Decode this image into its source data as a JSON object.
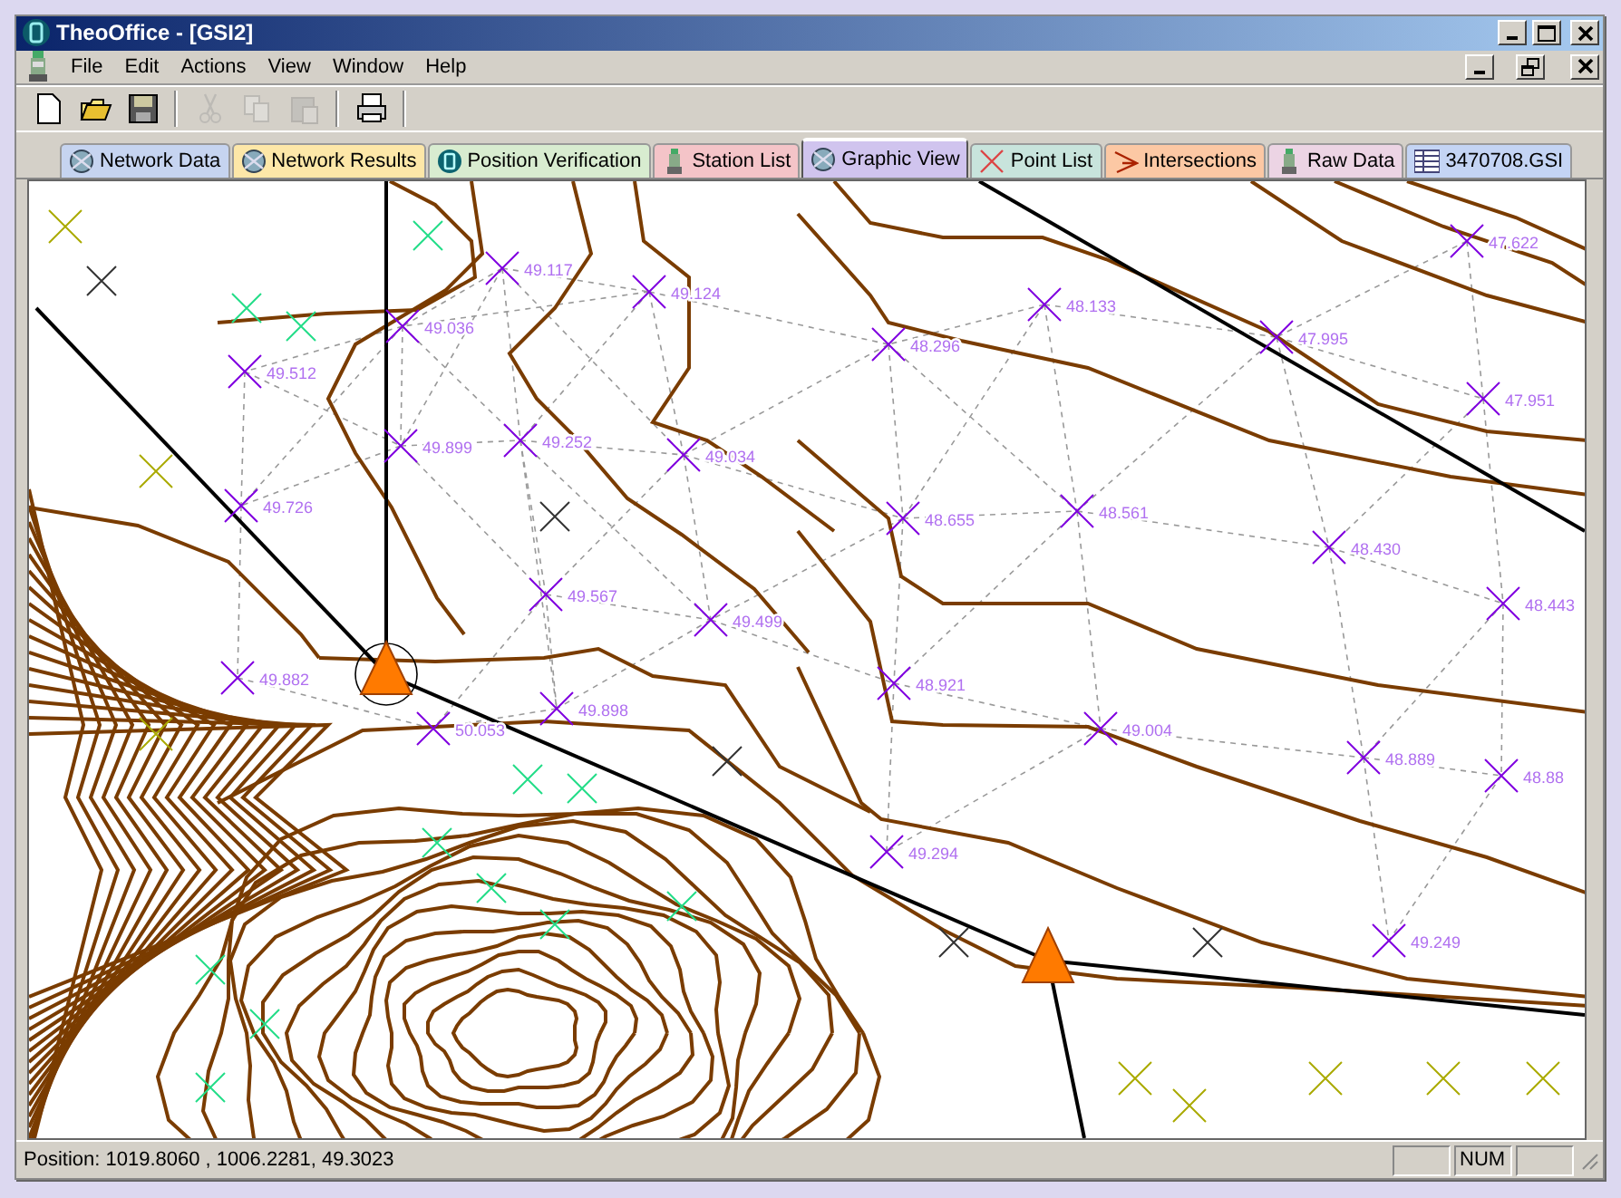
{
  "window": {
    "title": "TheoOffice - [GSI2]"
  },
  "menu": [
    "File",
    "Edit",
    "Actions",
    "View",
    "Window",
    "Help"
  ],
  "toolbar": [
    {
      "kind": "new",
      "disabled": false
    },
    {
      "kind": "open",
      "disabled": false
    },
    {
      "kind": "save",
      "disabled": false
    },
    {
      "kind": "separator"
    },
    {
      "kind": "cut",
      "disabled": true
    },
    {
      "kind": "copy",
      "disabled": true
    },
    {
      "kind": "paste",
      "disabled": true
    },
    {
      "kind": "separator"
    },
    {
      "kind": "print",
      "disabled": false
    },
    {
      "kind": "separator"
    }
  ],
  "tabs": [
    {
      "label": "Network Data",
      "kind": "globe",
      "color": "#c6d4f0",
      "selected": false
    },
    {
      "label": "Network Results",
      "kind": "globe",
      "color": "#fde7a8",
      "selected": false
    },
    {
      "label": "Position Verification",
      "kind": "logo",
      "color": "#d8ecd0",
      "selected": false
    },
    {
      "label": "Station List",
      "kind": "instrument",
      "color": "#f4c4c8",
      "selected": false
    },
    {
      "label": "Graphic View",
      "kind": "globe",
      "color": "#d0c4ee",
      "selected": true
    },
    {
      "label": "Point List",
      "kind": "cross",
      "color": "#c8e4dc",
      "selected": false
    },
    {
      "label": "Intersections",
      "kind": "angle",
      "color": "#fcc8a4",
      "selected": false
    },
    {
      "label": "Raw Data",
      "kind": "instrument",
      "color": "#ecd4e4",
      "selected": false
    },
    {
      "label": "3470708.GSI",
      "kind": "table",
      "color": "#c4d4f4",
      "selected": false
    }
  ],
  "map": {
    "points": [
      {
        "label": "47.622"
      },
      {
        "label": "49.117"
      },
      {
        "label": "49.124"
      },
      {
        "label": "48.133"
      },
      {
        "label": "49.036"
      },
      {
        "label": "48.296"
      },
      {
        "label": "47.995"
      },
      {
        "label": "49.512"
      },
      {
        "label": "47.951"
      },
      {
        "label": "49.899"
      },
      {
        "label": "49.252"
      },
      {
        "label": "49.034"
      },
      {
        "label": "49.726"
      },
      {
        "label": "48.655"
      },
      {
        "label": "48.561"
      },
      {
        "label": "48.430"
      },
      {
        "label": "49.567"
      },
      {
        "label": "48.443"
      },
      {
        "label": "49.499"
      },
      {
        "label": "49.882"
      },
      {
        "label": "48.921"
      },
      {
        "label": "49.898"
      },
      {
        "label": "50.053"
      },
      {
        "label": "49.004"
      },
      {
        "label": "48.889"
      },
      {
        "label": "48.88"
      },
      {
        "label": "49.294"
      },
      {
        "label": "49.249"
      }
    ]
  },
  "status_bar": {
    "position": "Position: 1019.8060 , 1006.2281, 49.3023",
    "indicator": "NUM"
  }
}
